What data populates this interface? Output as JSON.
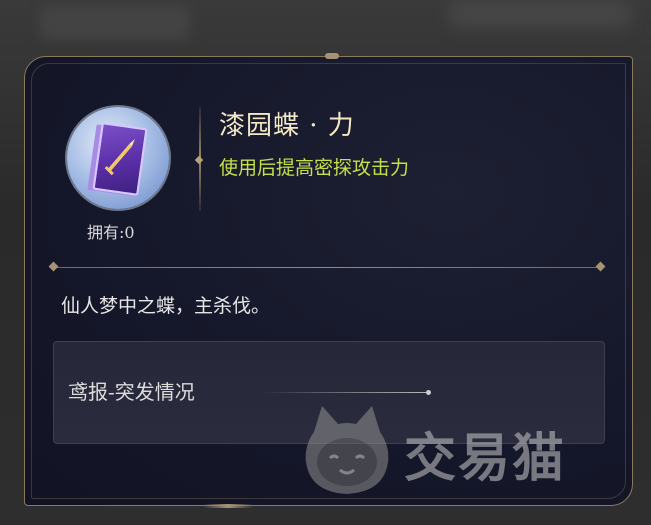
{
  "item": {
    "name": "漆园蝶 · 力",
    "effect": "使用后提高密探攻击力",
    "owned": "拥有:0",
    "icon": "butterfly-card-icon"
  },
  "description": {
    "flavor": "仙人梦中之蝶，主杀伐。"
  },
  "source": {
    "label": "鸢报-突发情况"
  },
  "watermark": {
    "text": "交易猫",
    "icon": "cat-logo-icon"
  },
  "colors": {
    "title": "#f3e7c6",
    "effect": "#c4e04a",
    "border_gold": "#8a7a5c",
    "panel_bg": "#15172a"
  }
}
